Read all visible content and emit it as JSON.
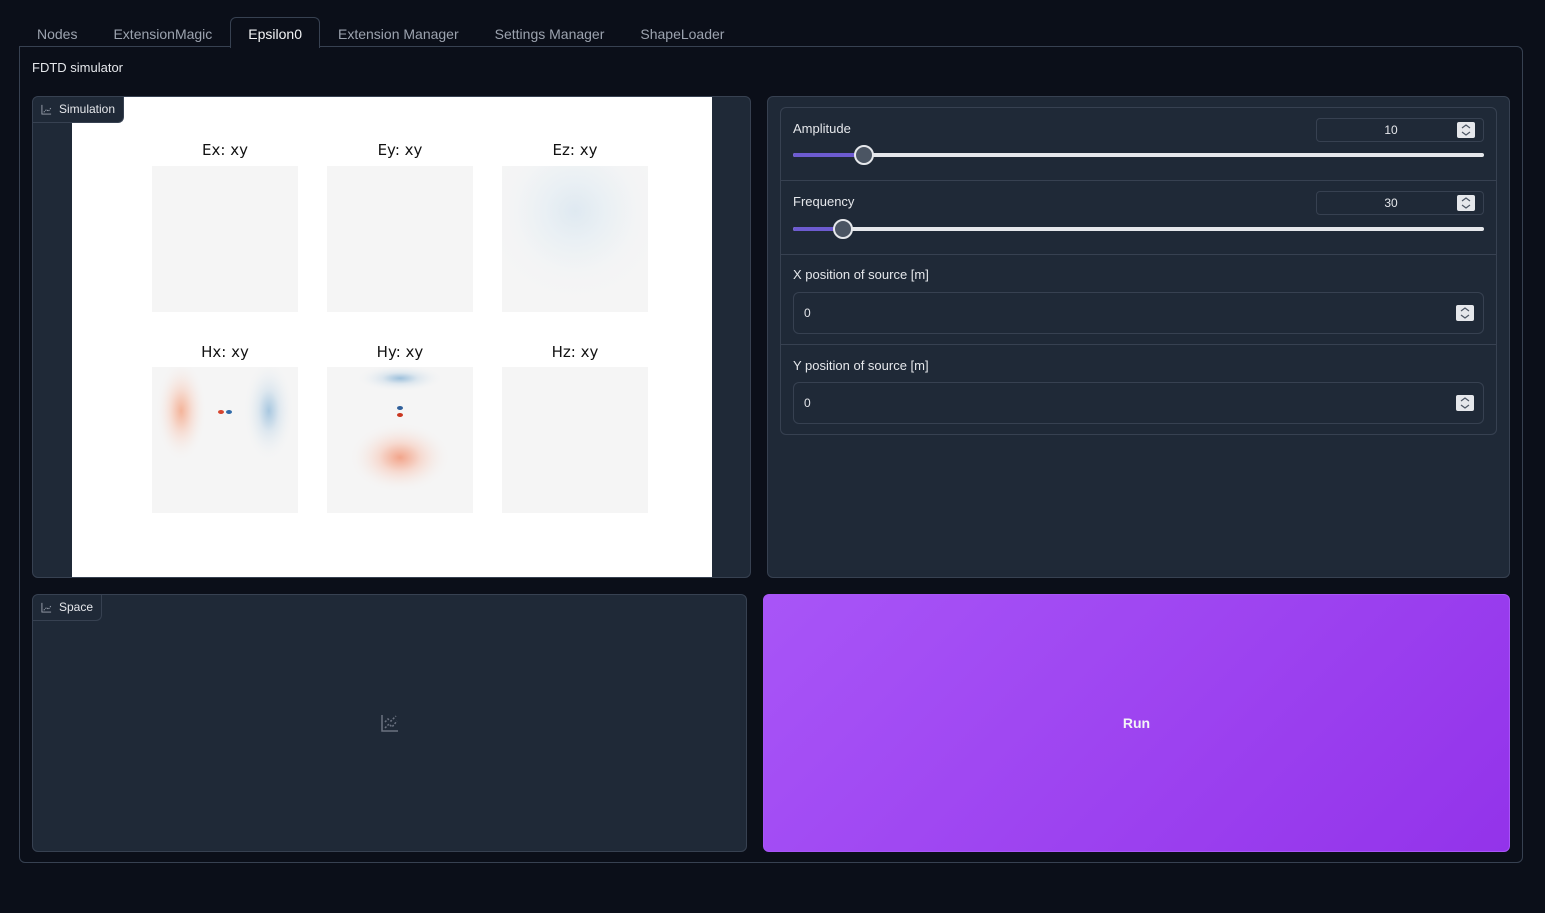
{
  "tabs": [
    {
      "label": "Nodes",
      "active": false
    },
    {
      "label": "ExtensionMagic",
      "active": false
    },
    {
      "label": "Epsilon0",
      "active": true
    },
    {
      "label": "Extension Manager",
      "active": false
    },
    {
      "label": "Settings Manager",
      "active": false
    },
    {
      "label": "ShapeLoader",
      "active": false
    }
  ],
  "app": {
    "title": "FDTD simulator"
  },
  "simulation": {
    "label": "Simulation",
    "subplots": [
      {
        "title": "Ex: xy"
      },
      {
        "title": "Ey: xy"
      },
      {
        "title": "Ez: xy"
      },
      {
        "title": "Hx: xy"
      },
      {
        "title": "Hy: xy"
      },
      {
        "title": "Hz: xy"
      }
    ]
  },
  "space": {
    "label": "Space"
  },
  "controls": {
    "amplitude": {
      "label": "Amplitude",
      "value": "10",
      "fraction": 0.103
    },
    "frequency": {
      "label": "Frequency",
      "value": "30",
      "fraction": 0.072
    },
    "x_position": {
      "label": "X position of source [m]",
      "value": "0"
    },
    "y_position": {
      "label": "Y position of source [m]",
      "value": "0"
    }
  },
  "run": {
    "label": "Run"
  },
  "colors": {
    "accent": "#a855f7",
    "slider": "#6d5bd0",
    "background": "#0b0f19",
    "panel": "#1f2937"
  }
}
